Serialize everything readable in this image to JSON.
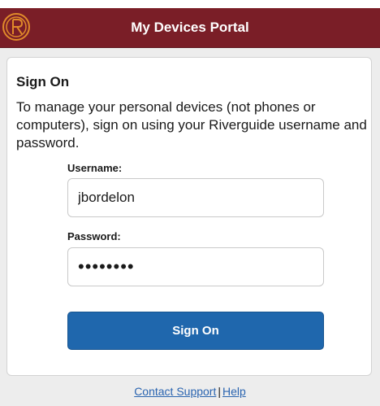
{
  "header": {
    "title": "My Devices Portal",
    "logo_icon": "riverguide-crest-logo",
    "background_color": "#7a1e27",
    "logo_color": "#e08a2a"
  },
  "signon": {
    "title": "Sign On",
    "description": "To manage your personal devices (not phones or computers), sign on using your Riverguide username and password.",
    "username_label": "Username:",
    "username_value": "jbordelon",
    "password_label": "Password:",
    "password_value": "••••••••",
    "button_label": "Sign On",
    "button_color": "#1f67ad"
  },
  "footer": {
    "contact_support": "Contact Support",
    "separator": "|",
    "help": "Help",
    "link_color": "#2a64b0"
  }
}
